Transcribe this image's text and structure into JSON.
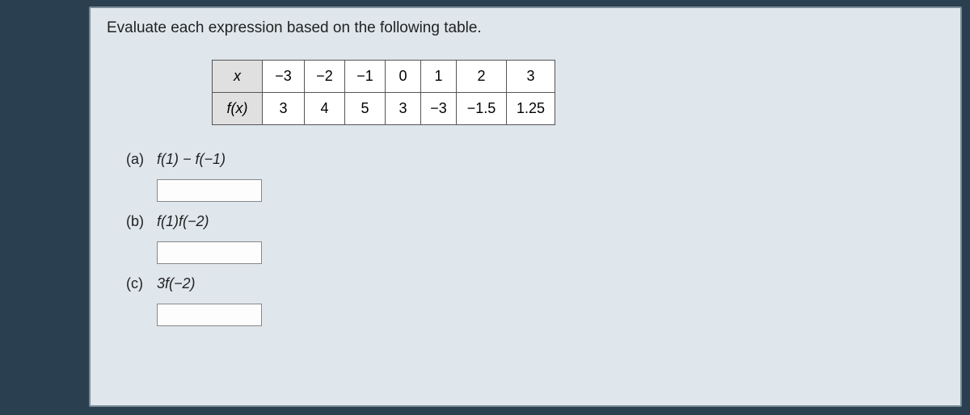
{
  "prompt": "Evaluate each expression based on the following table.",
  "table": {
    "row1_head": "x",
    "row2_head": "f(x)",
    "row1": [
      "−3",
      "−2",
      "−1",
      "0",
      "1",
      "2",
      "3"
    ],
    "row2": [
      "3",
      "4",
      "5",
      "3",
      "−3",
      "−1.5",
      "1.25"
    ]
  },
  "parts": {
    "a": {
      "label": "(a)",
      "expr": "f(1) − f(−1)",
      "value": ""
    },
    "b": {
      "label": "(b)",
      "expr": "f(1)f(−2)",
      "value": ""
    },
    "c": {
      "label": "(c)",
      "expr": "3f(−2)",
      "value": ""
    }
  }
}
